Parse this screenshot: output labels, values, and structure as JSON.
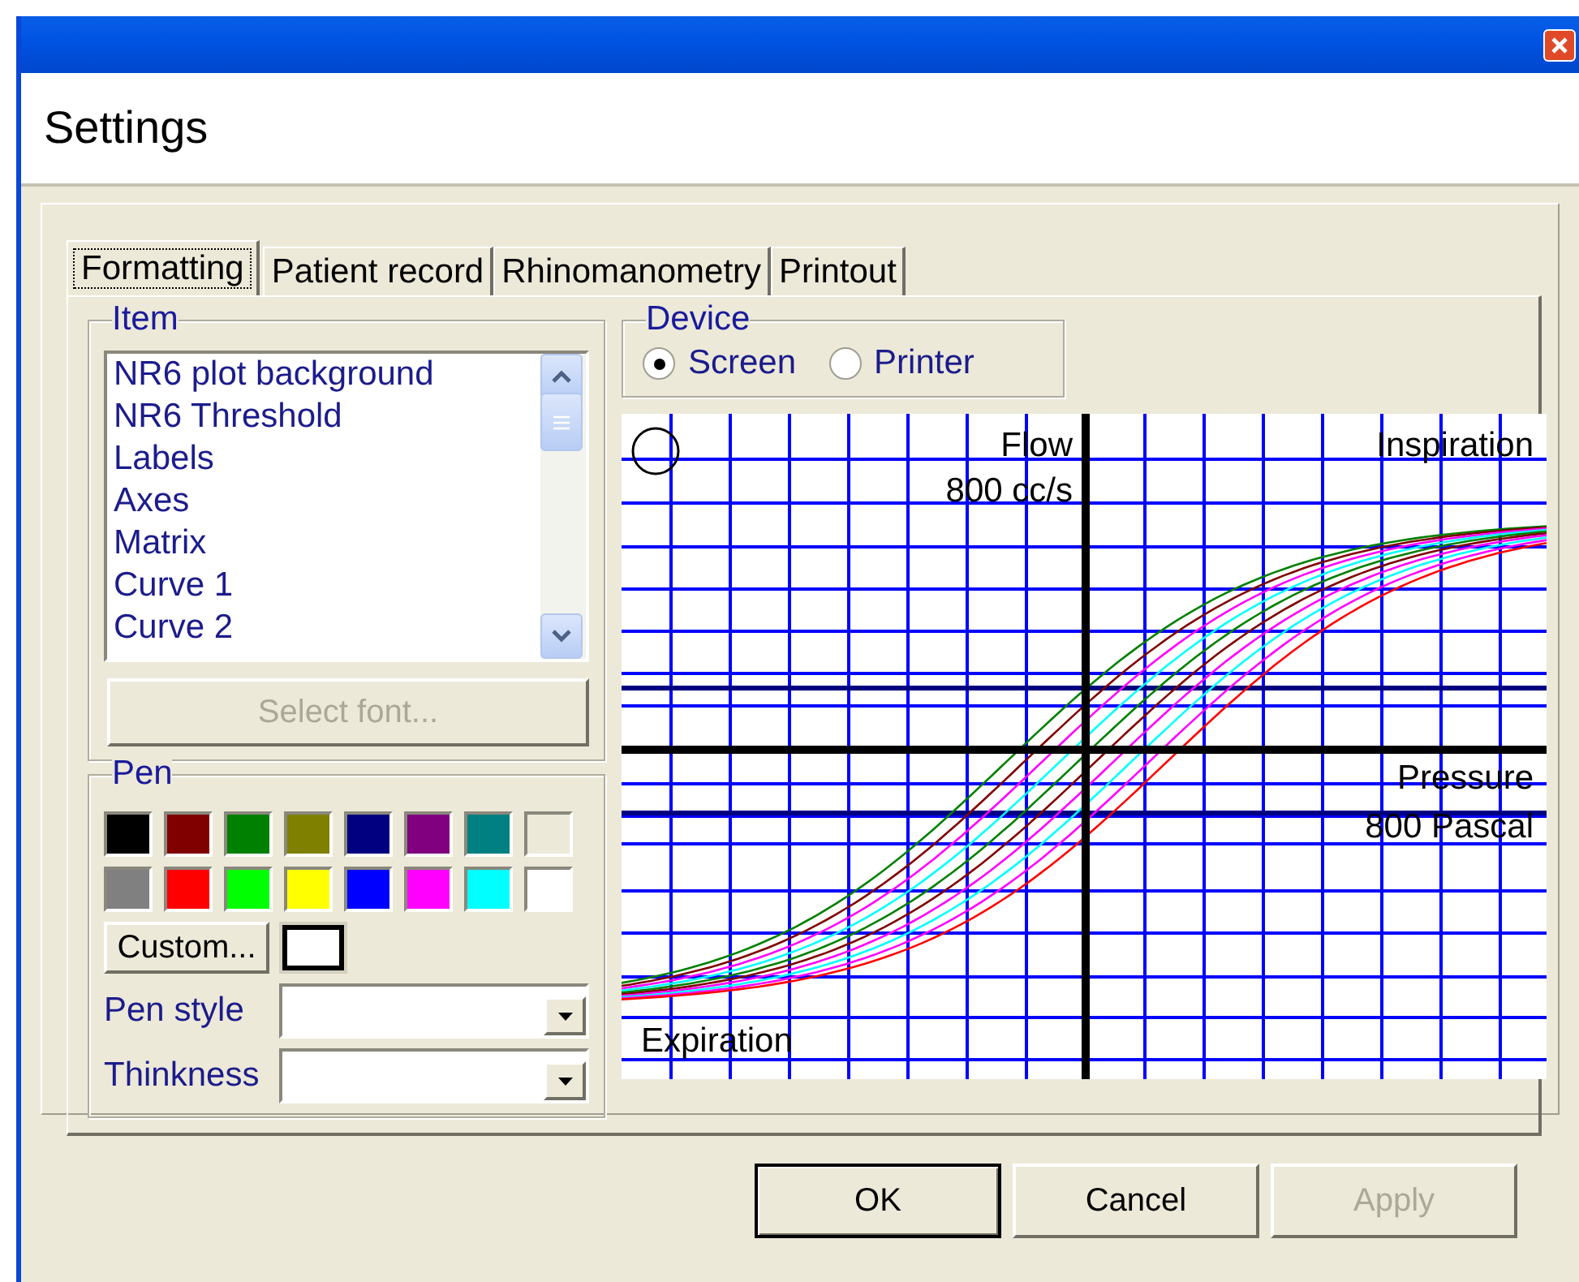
{
  "window": {
    "title": "Settings"
  },
  "tabs": [
    {
      "label": "Formatting",
      "selected": true
    },
    {
      "label": "Patient record",
      "selected": false
    },
    {
      "label": "Rhinomanometry",
      "selected": false
    },
    {
      "label": "Printout",
      "selected": false
    }
  ],
  "item_group": {
    "label": "Item",
    "items": [
      {
        "label": "NR6 plot background",
        "selected": false
      },
      {
        "label": "NR6 Threshold",
        "selected": false
      },
      {
        "label": "Labels",
        "selected": false
      },
      {
        "label": "Axes",
        "selected": false
      },
      {
        "label": "Matrix",
        "selected": false
      },
      {
        "label": "Curve 1",
        "selected": false
      },
      {
        "label": "Curve 2",
        "selected": false
      }
    ],
    "select_font_button": {
      "label": "Select font...",
      "disabled": true
    }
  },
  "device_group": {
    "label": "Device",
    "options": [
      {
        "label": "Screen",
        "selected": true
      },
      {
        "label": "Printer",
        "selected": false
      }
    ]
  },
  "pen_group": {
    "label": "Pen",
    "swatches": [
      {
        "color": "#000000"
      },
      {
        "color": "#800000"
      },
      {
        "color": "#008000"
      },
      {
        "color": "#808000"
      },
      {
        "color": "#000080"
      },
      {
        "color": "#800080"
      },
      {
        "color": "#008080"
      },
      {
        "color": "#ece9d8"
      },
      {
        "color": "#808080"
      },
      {
        "color": "#ff0000"
      },
      {
        "color": "#00ff00"
      },
      {
        "color": "#ffff00"
      },
      {
        "color": "#0000ff"
      },
      {
        "color": "#ff00ff"
      },
      {
        "color": "#00ffff"
      },
      {
        "color": "#ffffff"
      }
    ],
    "custom_button": {
      "label": "Custom..."
    },
    "custom_swatch": {
      "color": "#ffffff"
    },
    "fields": [
      {
        "label": "Pen style"
      },
      {
        "label": "Thinkness"
      }
    ]
  },
  "preview": {
    "flow_label": "Flow",
    "flow_scale": "800 cc/s",
    "inspiration_label": "Inspiration",
    "pressure_label": "Pressure",
    "pressure_scale": "800 Pascal",
    "expiration_label": "Expiration"
  },
  "buttons": [
    {
      "label": "OK",
      "default": true,
      "disabled": false
    },
    {
      "label": "Cancel",
      "default": false,
      "disabled": false
    },
    {
      "label": "Apply",
      "default": false,
      "disabled": true
    }
  ]
}
